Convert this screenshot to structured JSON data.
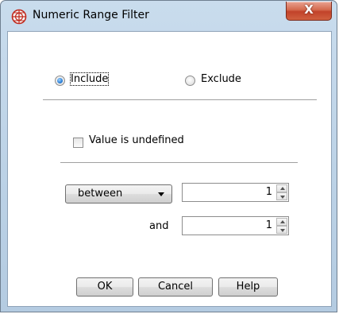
{
  "window": {
    "title": "Numeric Range Filter",
    "app_icon": "globe-grid-icon",
    "close_label": "X",
    "accent_colors": {
      "close_button": "#c7462c",
      "radio_selected": "#2b7fd6"
    }
  },
  "mode": {
    "include_label": "Include",
    "exclude_label": "Exclude",
    "selected": "Include"
  },
  "undefined_option": {
    "label": "Value is undefined",
    "checked": false
  },
  "range": {
    "operator": "between",
    "from_value": "1",
    "and_label": "and",
    "to_value": "1"
  },
  "buttons": {
    "ok": "OK",
    "cancel": "Cancel",
    "help": "Help"
  }
}
